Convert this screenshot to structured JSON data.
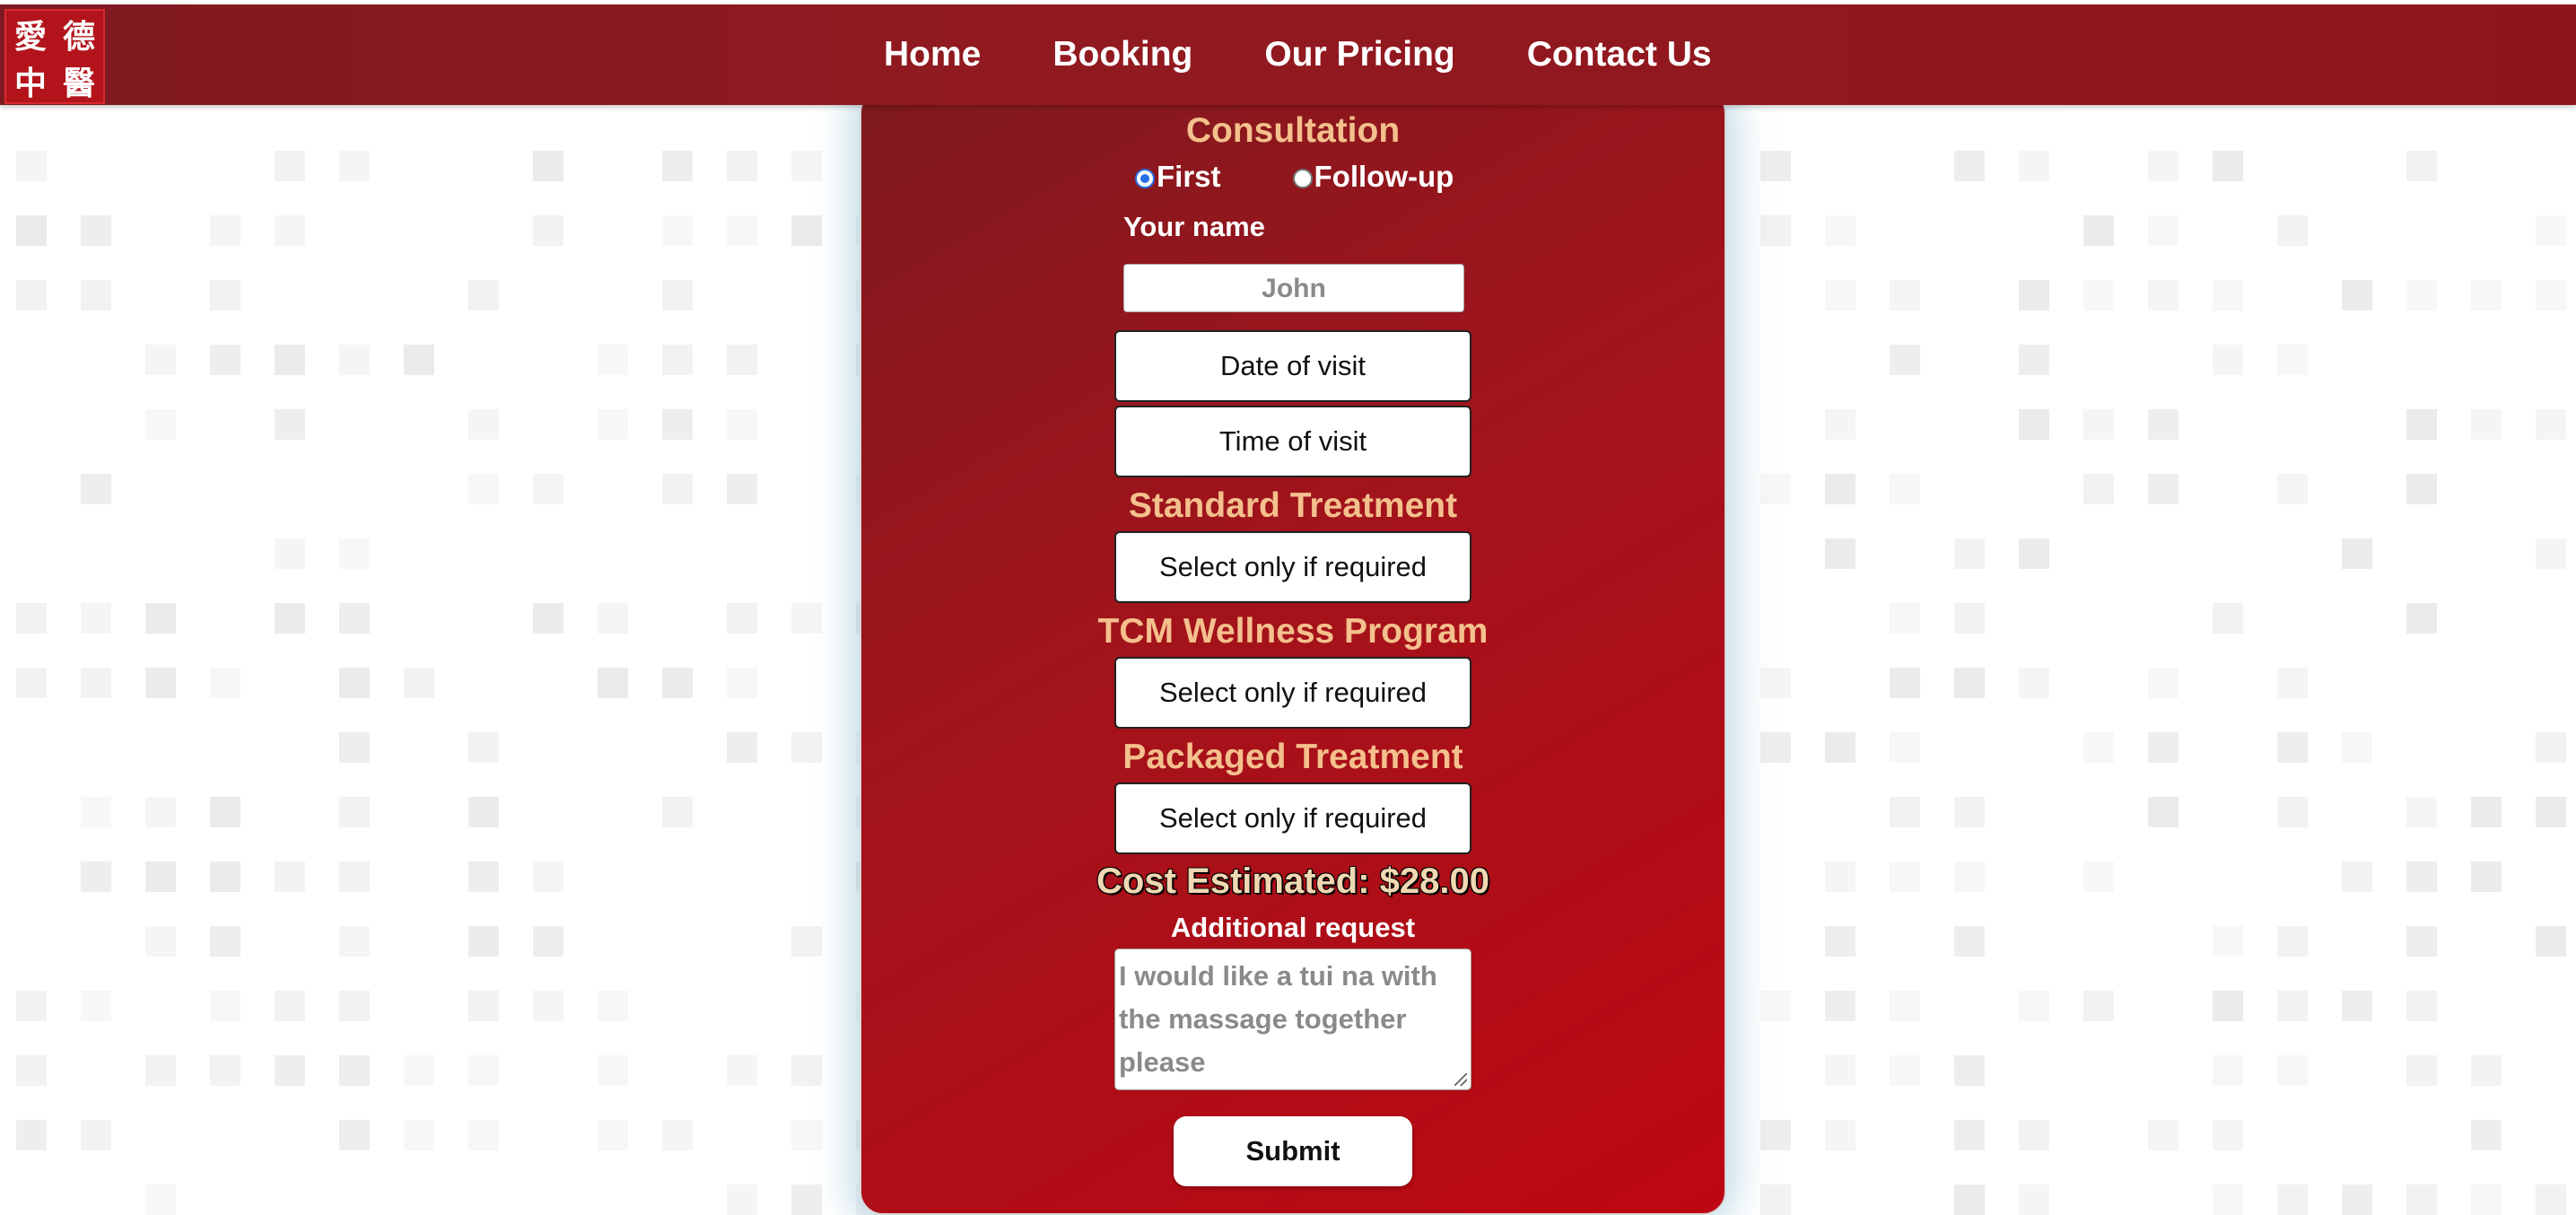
{
  "logo": {
    "chars": [
      "愛",
      "德",
      "中",
      "醫"
    ]
  },
  "nav": {
    "items": [
      {
        "label": "Home"
      },
      {
        "label": "Booking"
      },
      {
        "label": "Our Pricing"
      },
      {
        "label": "Contact Us"
      }
    ]
  },
  "form": {
    "consultation_title": "Consultation",
    "consultation_options": [
      {
        "label": "First",
        "checked": true
      },
      {
        "label": "Follow-up",
        "checked": false
      }
    ],
    "name_label": "Your name",
    "name_placeholder": "John",
    "date_button": "Date of visit",
    "time_button": "Time of visit",
    "standard_title": "Standard Treatment",
    "standard_select": "Select only if required",
    "wellness_title": "TCM Wellness Program",
    "wellness_select": "Select only if required",
    "packaged_title": "Packaged Treatment",
    "packaged_select": "Select only if required",
    "cost_text": "Cost Estimated: $28.00",
    "additional_label": "Additional request",
    "additional_placeholder": "I would like a tui na with the massage together please",
    "submit_label": "Submit"
  },
  "colors": {
    "nav_bg": "#8f151c",
    "card_accent": "#bd0712",
    "section_title": "#f4c08d",
    "radio_selected": "#2670e8"
  }
}
